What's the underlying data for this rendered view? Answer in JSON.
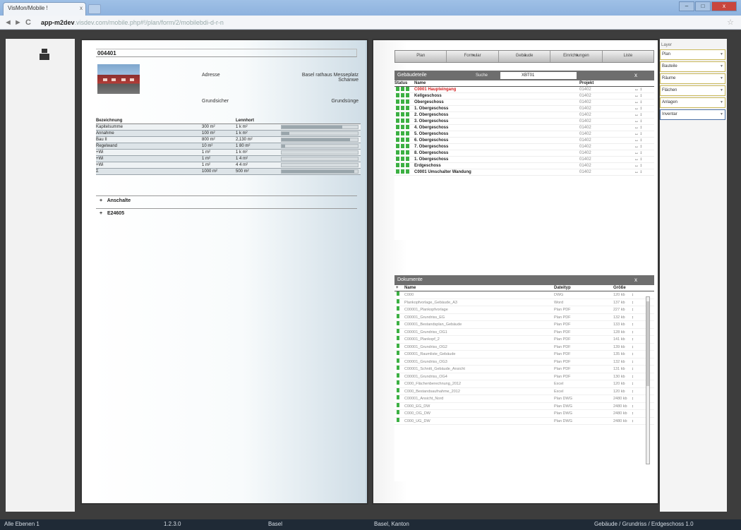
{
  "browser": {
    "tab_title": "VisMon/Mobile !",
    "tab_close": "x",
    "url_host": "app-m2dev",
    "url_path": ".visdev.com/mobile.php#!/plan/form/2/mobilebdi-d-r-n",
    "back_glyph": "◄",
    "forward_glyph": "►",
    "reload_glyph": "C",
    "star_glyph": "☆",
    "win_min": "–",
    "win_max": "□",
    "win_close": "x"
  },
  "left_pane": {
    "object_code": "004401",
    "photo_icon": "building-photo",
    "address_label": "Adresse",
    "address_value": "Basel rathaus Messeplatz",
    "address_value2": "Schanwe",
    "usage_label": "Grundsicher",
    "usage_value": "Grundsünge",
    "area_table": {
      "col1": "Bezeichnung",
      "col2": "Lennhort",
      "rows": [
        {
          "name": "Kapitelsumme",
          "v1": "300 m²",
          "v2": "1 k m²",
          "fill": 0.8
        },
        {
          "name": "Annahme",
          "v1": "100 m²",
          "v2": "1 k m²",
          "fill": 0.1
        },
        {
          "name": "Bau II",
          "v1": "800 m²",
          "v2": "2,130 m²",
          "fill": 0.9
        },
        {
          "name": "Regelwand",
          "v1": "10 m²",
          "v2": "1 80 m²",
          "fill": 0.05
        },
        {
          "name": "+Wi",
          "v1": "1 m²",
          "v2": "1 k m²",
          "fill": 0.0
        },
        {
          "name": "+Wi",
          "v1": "1 m²",
          "v2": "1 4 m²",
          "fill": 0.0
        },
        {
          "name": "+Wi",
          "v1": "1 m²",
          "v2": "4 4 m²",
          "fill": 0.0
        },
        {
          "name": "Σ",
          "v1": "1000 m²",
          "v2": "500 m²",
          "fill": 0.95
        }
      ]
    },
    "sections": [
      {
        "plus": "+",
        "label": "Anschalte"
      },
      {
        "plus": "+",
        "label": "E24605"
      }
    ]
  },
  "right_pane": {
    "toolbar": [
      "Plan",
      "Formular",
      "Gebäude",
      "Einrichtungen",
      "Liste"
    ],
    "floors_panel": {
      "title": "Gebäudeteile",
      "filter_label": "Suche",
      "filter_value": "XBT01",
      "close": "x",
      "columns": {
        "status": "Status",
        "name": "Name",
        "project": "Projekt"
      },
      "rows": [
        {
          "name": "C0001 Haupteingang",
          "project": "01402",
          "red": true
        },
        {
          "name": "Kellgeschoss",
          "project": "01402",
          "red": false
        },
        {
          "name": "Obergeschoss",
          "project": "01402",
          "red": false
        },
        {
          "name": "1. Obergeschoss",
          "project": "01402",
          "red": false
        },
        {
          "name": "2. Obergeschoss",
          "project": "01402",
          "red": false
        },
        {
          "name": "3. Obergeschoss",
          "project": "01402",
          "red": false
        },
        {
          "name": "4. Obergeschoss",
          "project": "01402",
          "red": false
        },
        {
          "name": "5. Obergeschoss",
          "project": "01402",
          "red": false
        },
        {
          "name": "6. Obergeschoss",
          "project": "01402",
          "red": false
        },
        {
          "name": "7. Obergeschoss",
          "project": "01402",
          "red": false
        },
        {
          "name": "8. Obergeschoss",
          "project": "01402",
          "red": false
        },
        {
          "name": "1. Obergeschoss",
          "project": "01402",
          "red": false
        },
        {
          "name": "Erdgeschoss",
          "project": "01402",
          "red": false
        },
        {
          "name": "C0001 Umschalter Wandung",
          "project": "01402",
          "red": false
        }
      ],
      "row_action": "↔ ↕"
    },
    "docs_panel": {
      "title": "Dokumente",
      "close": "x",
      "columns": {
        "marker": "+",
        "name": "Name",
        "type": "Dateityp",
        "size": "Größe"
      },
      "rows": [
        {
          "name": "C000",
          "type": "DWG",
          "size": "120 kb"
        },
        {
          "name": "Plankopfvorlage_Gebäude_A3",
          "type": "Word",
          "size": "137 kb"
        },
        {
          "name": "C00001_Plankopfvorlage",
          "type": "Plan PDF",
          "size": "227 kb"
        },
        {
          "name": "C00001_Grundriss_EG",
          "type": "Plan PDF",
          "size": "132 kb"
        },
        {
          "name": "C00001_Bestandsplan_Gebäude",
          "type": "Plan PDF",
          "size": "133 kb"
        },
        {
          "name": "C00001_Grundriss_OG1",
          "type": "Plan PDF",
          "size": "128 kb"
        },
        {
          "name": "C00001_Plankopf_2",
          "type": "Plan PDF",
          "size": "141 kb"
        },
        {
          "name": "C00001_Grundriss_OG2",
          "type": "Plan PDF",
          "size": "139 kb"
        },
        {
          "name": "C00001_Raumliste_Gebäude",
          "type": "Plan PDF",
          "size": "135 kb"
        },
        {
          "name": "C00001_Grundriss_OG3",
          "type": "Plan PDF",
          "size": "132 kb"
        },
        {
          "name": "C00001_Schnitt_Gebäude_Ansicht",
          "type": "Plan PDF",
          "size": "131 kb"
        },
        {
          "name": "C00001_Grundriss_OG4",
          "type": "Plan PDF",
          "size": "130 kb"
        },
        {
          "name": "C000_Flächenberechnung_2012",
          "type": "Excel",
          "size": "120 kb"
        },
        {
          "name": "C000_Bestandsaufnahme_2012",
          "type": "Excel",
          "size": "120 kb"
        },
        {
          "name": "C00001_Ansicht_Nord",
          "type": "Plan DWG",
          "size": "2480 kb"
        },
        {
          "name": "C000_EG_DW",
          "type": "Plan DWG",
          "size": "2480 kb"
        },
        {
          "name": "C000_OG_DW",
          "type": "Plan DWG",
          "size": "2480 kb"
        },
        {
          "name": "C000_UG_DW",
          "type": "Plan DWG",
          "size": "2480 kb"
        }
      ],
      "row_action": "↕"
    }
  },
  "right_column": {
    "title": "Layer",
    "items": [
      "Plan",
      "Bauteile",
      "Räume",
      "Flächen",
      "Anlagen",
      "Inventar"
    ],
    "dropdown_glyph": "▼"
  },
  "taskbar": {
    "left": "Alle Ebenen 1",
    "mid1": "1.2.3.0",
    "mid2": "Basel",
    "mid3": "Basel, Kanton",
    "right": "Gebäude / Grundriss / Erdgeschoss 1.0"
  }
}
